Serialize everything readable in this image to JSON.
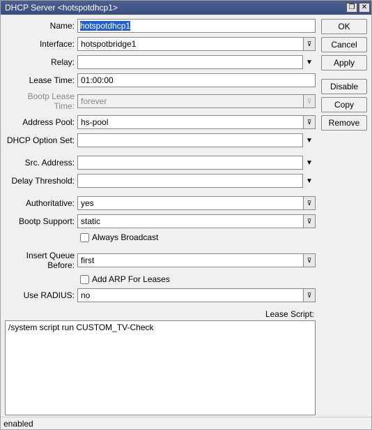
{
  "window": {
    "title": "DHCP Server <hotspotdhcp1>"
  },
  "fields": {
    "name": {
      "label": "Name:",
      "value": "hotspotdhcp1",
      "selected": true
    },
    "interface": {
      "label": "Interface:",
      "value": "hotspotbridge1"
    },
    "relay": {
      "label": "Relay:",
      "value": ""
    },
    "lease_time": {
      "label": "Lease Time:",
      "value": "01:00:00"
    },
    "bootp_lease_time": {
      "label": "Bootp Lease Time:",
      "value": "forever",
      "disabled": true
    },
    "address_pool": {
      "label": "Address Pool:",
      "value": "hs-pool"
    },
    "dhcp_option_set": {
      "label": "DHCP Option Set:",
      "value": ""
    },
    "src_address": {
      "label": "Src. Address:",
      "value": ""
    },
    "delay_threshold": {
      "label": "Delay Threshold:",
      "value": ""
    },
    "authoritative": {
      "label": "Authoritative:",
      "value": "yes"
    },
    "bootp_support": {
      "label": "Bootp Support:",
      "value": "static"
    },
    "always_broadcast": {
      "label": "Always Broadcast",
      "checked": false
    },
    "insert_queue_before": {
      "label": "Insert Queue Before:",
      "value": "first"
    },
    "add_arp": {
      "label": "Add ARP For Leases",
      "checked": false
    },
    "use_radius": {
      "label": "Use RADIUS:",
      "value": "no"
    },
    "lease_script": {
      "label": "Lease Script:",
      "value": "/system script run CUSTOM_TV-Check"
    }
  },
  "buttons": {
    "ok": "OK",
    "cancel": "Cancel",
    "apply": "Apply",
    "disable": "Disable",
    "copy": "Copy",
    "remove": "Remove"
  },
  "status": "enabled"
}
